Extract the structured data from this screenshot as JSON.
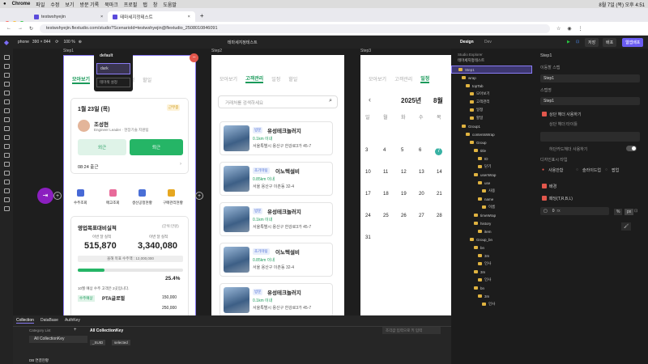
{
  "menubar": {
    "items": [
      "Chrome",
      "파일",
      "수정",
      "보기",
      "방문 기록",
      "북마크",
      "프로필",
      "탭",
      "창",
      "도움말"
    ],
    "clock": "8월 7일 (목) 오후 4:51"
  },
  "browser": {
    "tabs": [
      "testwshyejin",
      "테마세지정테스트"
    ],
    "url": "testwshyejin.flextudio.com/studio?ScenarioId=testwshyejin@flextudio_2508010846091"
  },
  "apptop": {
    "device": "phone",
    "size": "390 × 844",
    "zoom": "100 %",
    "project": "테마세지정테스트",
    "tab_design": "Design",
    "tab_dev": "Dev",
    "save": "저장",
    "deploy": "배포",
    "publish": "웹앱배포"
  },
  "theme_menu": {
    "items": [
      "default",
      "dark"
    ],
    "button": "테마색 설정"
  },
  "step1": {
    "label": "Step1",
    "tabs": [
      "모아보기",
      "일정",
      "할일"
    ],
    "date": "1월 23일 (목)",
    "status": "근무중",
    "name": "조성현",
    "role": "Engineer Leader · 현장기술 지원팀",
    "btn_out": "외근",
    "btn_leave": "퇴근",
    "checkin": "08:24 출근",
    "quick": [
      "수주조회",
      "매고조회",
      "생산공정현황",
      "구매관리현황"
    ],
    "sales_title": "영업목표대비실적",
    "sales_unit": "(단위:만원)",
    "lbl_month": "이번 달 실적",
    "lbl_target": "이번 달 실적",
    "val_month": "515,870",
    "val_target": "3,340,080",
    "goal": "올해 목표 수주액 : 12,000,000",
    "percent": "25.4%",
    "note": "10월 예상 수주 고객은 2곳입니다.",
    "tag1": "수주예상",
    "client1": "PTA글로벌",
    "amt1": "150,000",
    "amt2": "250,000"
  },
  "step2": {
    "label": "Step2",
    "tabs": [
      "모아보기",
      "고객관리",
      "일정",
      "할일"
    ],
    "search_placeholder": "거래처를 검색하세요",
    "list": [
      {
        "tag": "방문",
        "title": "유성테크놀러지",
        "dist": "0.1km 이내",
        "addr": "서울특별시 용산구 한강로3가 45-7"
      },
      {
        "tag": "초기미팅",
        "title": "이노텍설비",
        "dist": "0.85km 이내",
        "addr": "서울 용산구 이촌동 32-4"
      },
      {
        "tag": "방문",
        "title": "유성테크놀러지",
        "dist": "0.1km 이내",
        "addr": "서울특별시 용산구 한강로3가 45-7"
      },
      {
        "tag": "초기미팅",
        "title": "이노텍설비",
        "dist": "0.85km 이내",
        "addr": "서울 용산구 이촌동 32-4"
      },
      {
        "tag": "방문",
        "title": "유성테크놀러지",
        "dist": "0.1km 이내",
        "addr": "서울특별시 용산구 한강로3가 45-7"
      }
    ]
  },
  "step3": {
    "label": "Step3",
    "tabs": [
      "모아보기",
      "고객관리",
      "일정"
    ],
    "year": "2025년",
    "month": "8월",
    "weekdays": [
      "일",
      "월",
      "화",
      "수",
      "목"
    ],
    "weeks": [
      [
        "",
        "",
        "",
        "",
        ""
      ],
      [
        "3",
        "4",
        "5",
        "6",
        "7"
      ],
      [
        "10",
        "11",
        "12",
        "13",
        "14"
      ],
      [
        "17",
        "18",
        "19",
        "20",
        "21"
      ],
      [
        "24",
        "25",
        "26",
        "27",
        "28"
      ],
      [
        "31",
        "",
        "",
        "",
        ""
      ]
    ]
  },
  "bottom": {
    "tabs": [
      "Collection",
      "DataBase",
      "AuthKey"
    ],
    "category": "Category List",
    "all": "All CollectionKey",
    "header": "All CollectionKey",
    "chips": [
      "_SUID",
      "selected"
    ],
    "search": "조각값 입력으로 키 입력",
    "db": "DB 연결현황"
  },
  "explorer": {
    "title": "Studio Explorer",
    "project": "테마세지정테스트",
    "rows": [
      "Step1",
      "wrap",
      "topTab",
      "모아보기",
      "고객관리",
      "일정",
      "할일",
      "Group1",
      "contentsWrap",
      "Group",
      "title",
      "ID",
      "닫기",
      "userWrap",
      "use",
      "사용",
      "name",
      "이름",
      "timeWrap",
      "history",
      "item",
      "Group_bn",
      "bn",
      "3m",
      "인사",
      "3m",
      "인사",
      "bn",
      "3m",
      "인사"
    ]
  },
  "props": {
    "title": "Step1",
    "lbl_style": "이동할 스텝",
    "v_style": "Step1",
    "lbl_name": "스텝명",
    "v_name": "Step1",
    "hdr": "상단 헤더 사용하기",
    "hdr_title": "상단 헤더 타이틀",
    "bottom": "하단카드헤더 사용하기",
    "type_lbl": "디자인표시 타입",
    "types": [
      "사용안함",
      "슬라이드업",
      "팝업"
    ],
    "bg": "배경",
    "pad": "패딩(T,R,B,L)",
    "pad_val": "0",
    "pad_unit": "rx"
  }
}
